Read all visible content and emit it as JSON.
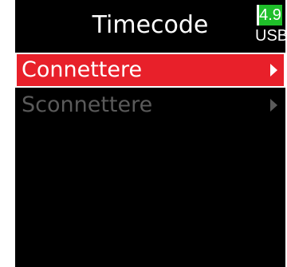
{
  "header": {
    "title": "Timecode"
  },
  "battery": {
    "value": "4.9",
    "source": "USB",
    "color": "#1fbf2a"
  },
  "menu": {
    "items": [
      {
        "label": "Connettere",
        "state": "selected",
        "icon": "chevron-right-icon"
      },
      {
        "label": "Sconnettere",
        "state": "disabled",
        "icon": "chevron-right-icon"
      }
    ]
  },
  "colors": {
    "selection": "#e8202a",
    "background": "#000000",
    "disabled_text": "#5a5a5a"
  }
}
